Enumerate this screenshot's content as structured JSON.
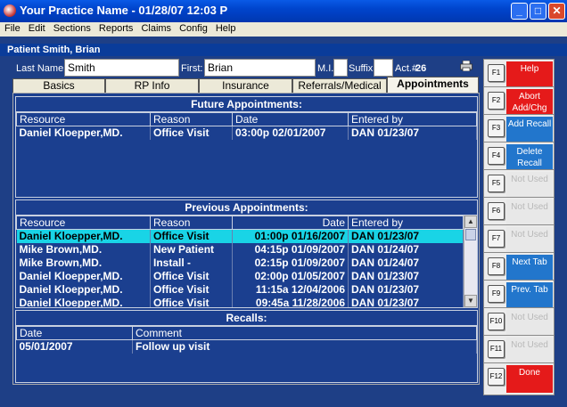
{
  "window": {
    "title": "Your Practice Name  -  01/28/07 12:03 P"
  },
  "menu": [
    "File",
    "Edit",
    "Sections",
    "Reports",
    "Claims",
    "Config",
    "Help"
  ],
  "patient": {
    "header": "Patient Smith, Brian",
    "last_name_label": "Last Name:",
    "last_name": "Smith",
    "first_label": "First:",
    "first": "Brian",
    "mi_label": "M.I.",
    "mi": "",
    "suffix_label": "Suffix",
    "suffix": "",
    "acct_label": "Act.#",
    "acct": "26"
  },
  "tabs": [
    "Basics",
    "RP Info",
    "Insurance",
    "Referrals/Medical",
    "Appointments"
  ],
  "future": {
    "title": "Future Appointments:",
    "columns": [
      "Resource",
      "Reason",
      "Date",
      "Entered by"
    ],
    "rows": [
      [
        "Daniel Kloepper,MD.",
        "Office Visit",
        "03:00p 02/01/2007",
        "DAN 01/23/07"
      ]
    ]
  },
  "previous": {
    "title": "Previous Appointments:",
    "columns": [
      "Resource",
      "Reason",
      "Date",
      "Entered by"
    ],
    "rows": [
      [
        "Daniel Kloepper,MD.",
        "Office Visit",
        "01:00p 01/16/2007",
        "DAN 01/23/07"
      ],
      [
        "Mike Brown,MD.",
        "New Patient",
        "04:15p 01/09/2007",
        "DAN 01/24/07"
      ],
      [
        "Mike Brown,MD.",
        "Install -",
        "02:15p 01/09/2007",
        "DAN 01/24/07"
      ],
      [
        "Daniel Kloepper,MD.",
        "Office Visit",
        "02:00p 01/05/2007",
        "DAN 01/23/07"
      ],
      [
        "Daniel Kloepper,MD.",
        "Office Visit",
        "11:15a 12/04/2006",
        "DAN 01/23/07"
      ],
      [
        "Daniel Kloepper,MD.",
        "Office Visit",
        "09:45a 11/28/2006",
        "DAN 01/23/07"
      ]
    ]
  },
  "recalls": {
    "title": "Recalls:",
    "columns": [
      "Date",
      "Comment"
    ],
    "rows": [
      [
        "05/01/2007",
        "Follow up visit"
      ]
    ]
  },
  "fkeys": [
    {
      "key": "F1",
      "label": "Help",
      "style": "red"
    },
    {
      "key": "F2",
      "label": "Abort Add/Chg",
      "style": "red"
    },
    {
      "key": "F3",
      "label": "Add Recall",
      "style": "blue"
    },
    {
      "key": "F4",
      "label": "Delete Recall",
      "style": "blue"
    },
    {
      "key": "F5",
      "label": "Not Used",
      "style": "gray"
    },
    {
      "key": "F6",
      "label": "Not Used",
      "style": "gray"
    },
    {
      "key": "F7",
      "label": "Not Used",
      "style": "gray"
    },
    {
      "key": "F8",
      "label": "Next Tab",
      "style": "blue"
    },
    {
      "key": "F9",
      "label": "Prev. Tab",
      "style": "blue"
    },
    {
      "key": "F10",
      "label": "Not Used",
      "style": "gray"
    },
    {
      "key": "F11",
      "label": "Not Used",
      "style": "gray"
    },
    {
      "key": "F12",
      "label": "Done",
      "style": "red"
    }
  ],
  "colors": {
    "background": "#1e3f86",
    "selected_row": "#19d4e6",
    "red_button": "#e51a1a",
    "blue_button": "#2276cc"
  }
}
